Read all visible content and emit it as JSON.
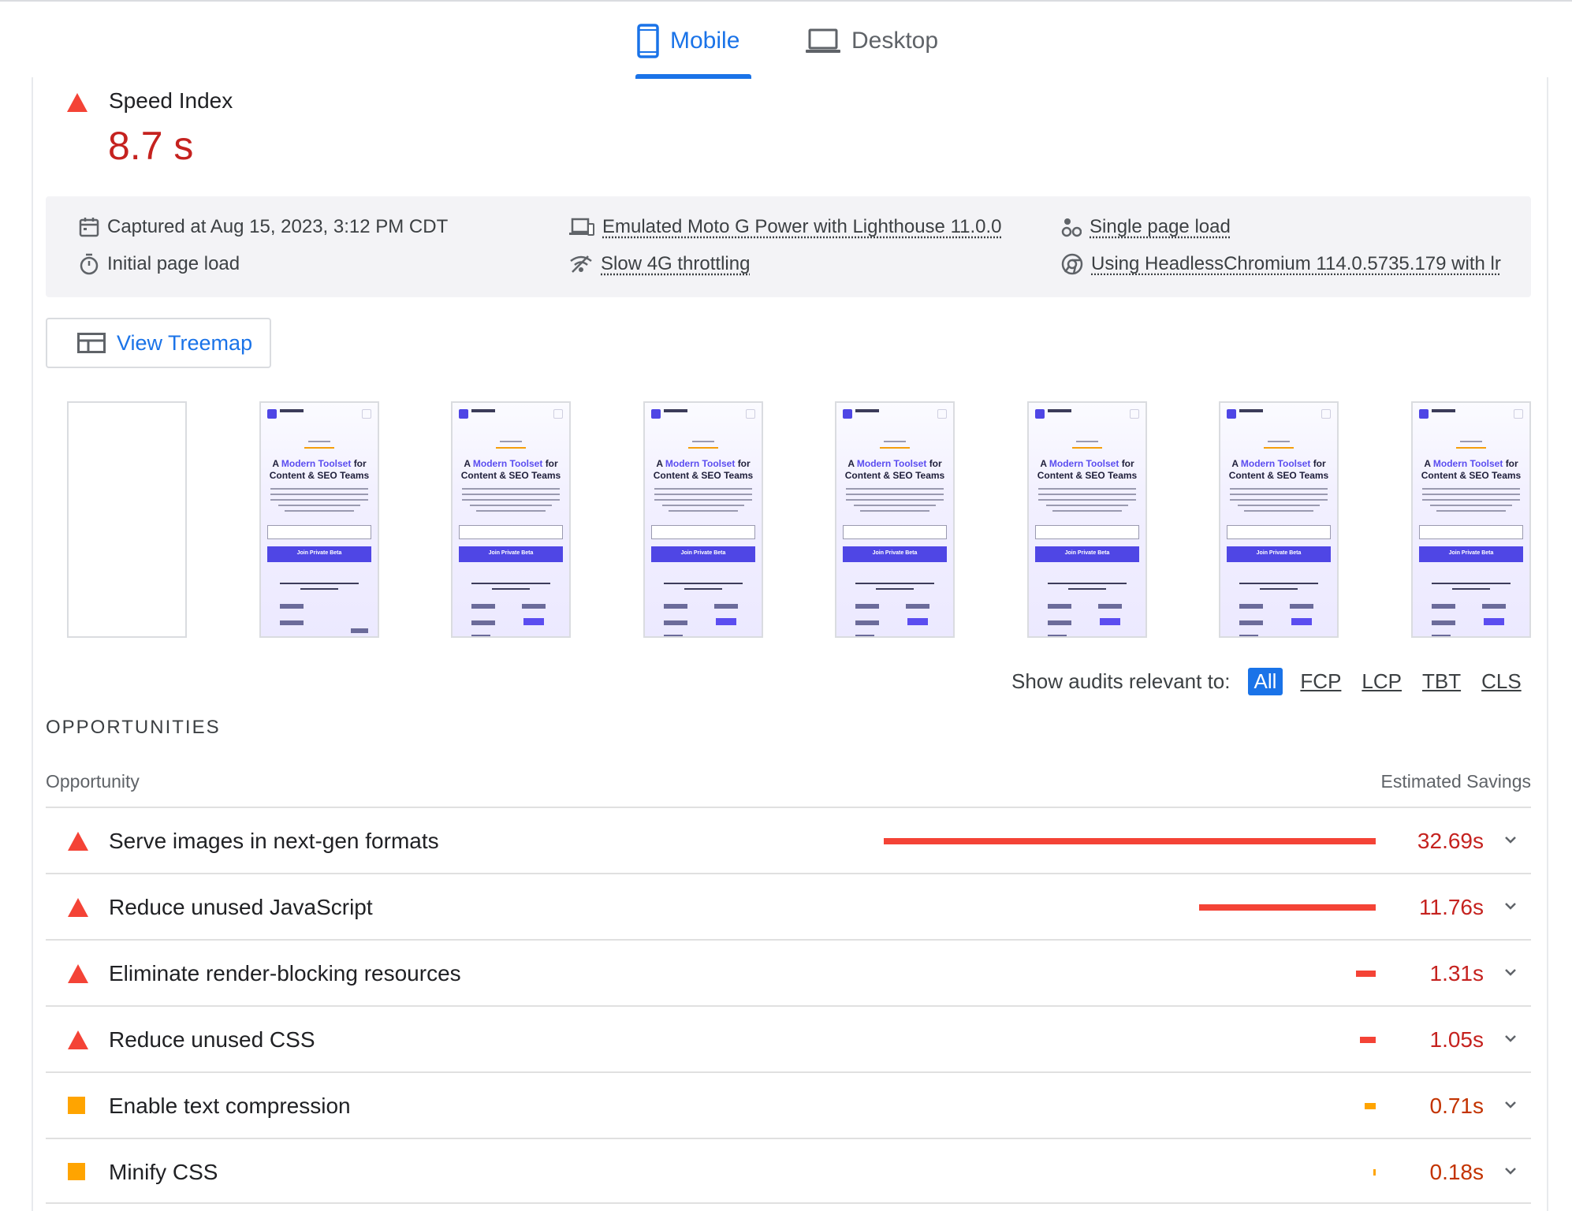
{
  "tabs": [
    {
      "label": "Mobile",
      "active": true,
      "icon": "phone-icon"
    },
    {
      "label": "Desktop",
      "active": false,
      "icon": "laptop-icon"
    }
  ],
  "metric": {
    "label": "Speed Index",
    "value": "8.7 s",
    "status": "fail"
  },
  "info": {
    "captured": "Captured at Aug 15, 2023, 3:12 PM CDT",
    "initial_load": "Initial page load",
    "emulated": "Emulated Moto G Power with Lighthouse 11.0.0",
    "throttling": "Slow 4G throttling",
    "single_load": "Single page load",
    "browser": "Using HeadlessChromium 114.0.5735.179 with lr"
  },
  "treemap_button": "View Treemap",
  "filmstrip": {
    "frame_count": 8,
    "screenshot_text": {
      "title_line1_prefix": "A",
      "title_line1_accent": "Modern Toolset",
      "title_line1_suffix": "for",
      "title_line2": "Content & SEO Teams",
      "button": "Join Private Beta"
    }
  },
  "filters": {
    "label": "Show audits relevant to:",
    "options": [
      "All",
      "FCP",
      "LCP",
      "TBT",
      "CLS"
    ],
    "active": "All"
  },
  "opportunities": {
    "section_title": "OPPORTUNITIES",
    "col_left": "Opportunity",
    "col_right": "Estimated Savings",
    "colors": {
      "fail": "#f44336",
      "average": "#ffa400"
    },
    "items": [
      {
        "title": "Serve images in next-gen formats",
        "savings": "32.69s",
        "seconds": 32.69,
        "status": "fail"
      },
      {
        "title": "Reduce unused JavaScript",
        "savings": "11.76s",
        "seconds": 11.76,
        "status": "fail"
      },
      {
        "title": "Eliminate render-blocking resources",
        "savings": "1.31s",
        "seconds": 1.31,
        "status": "fail"
      },
      {
        "title": "Reduce unused CSS",
        "savings": "1.05s",
        "seconds": 1.05,
        "status": "fail"
      },
      {
        "title": "Enable text compression",
        "savings": "0.71s",
        "seconds": 0.71,
        "status": "average"
      },
      {
        "title": "Minify CSS",
        "savings": "0.18s",
        "seconds": 0.18,
        "status": "average"
      }
    ]
  }
}
